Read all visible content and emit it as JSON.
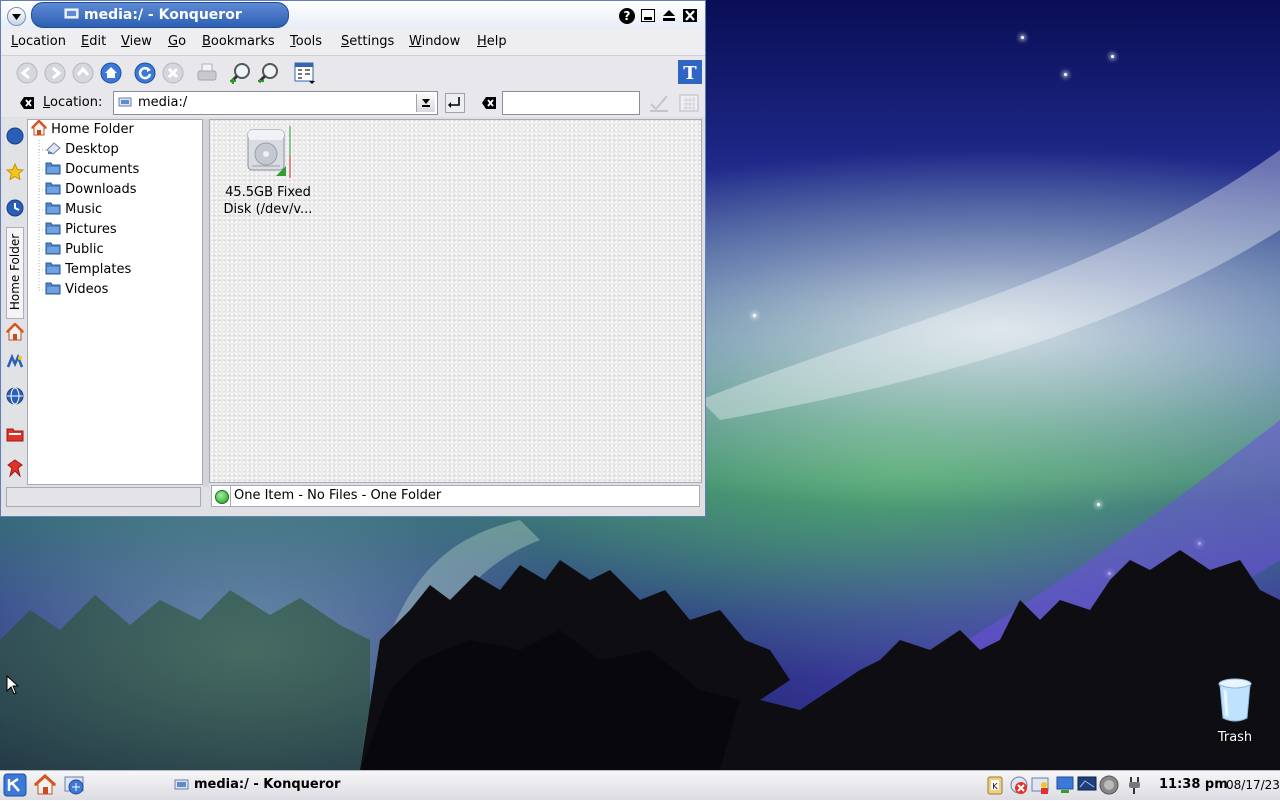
{
  "window": {
    "title": "media:/ - Konqueror"
  },
  "menubar": {
    "items": [
      {
        "label": "Location",
        "accel": "L",
        "rest": "ocation"
      },
      {
        "label": "Edit",
        "accel": "E",
        "rest": "dit"
      },
      {
        "label": "View",
        "accel": "V",
        "rest": "iew"
      },
      {
        "label": "Go",
        "accel": "G",
        "rest": "o"
      },
      {
        "label": "Bookmarks",
        "accel": "B",
        "rest": "ookmarks"
      },
      {
        "label": "Tools",
        "accel": "T",
        "rest": "ools"
      },
      {
        "label": "Settings",
        "accel": "S",
        "rest": "ettings"
      },
      {
        "label": "Window",
        "accel": "W",
        "rest": "indow"
      },
      {
        "label": "Help",
        "accel": "H",
        "rest": "elp"
      }
    ]
  },
  "toolbar": {
    "icons": [
      "back-icon",
      "forward-icon",
      "up-icon",
      "home-icon",
      "reload-icon",
      "stop-icon",
      "print-icon",
      "zoom-in-icon",
      "zoom-out-icon",
      "view-mode-icon",
      "konqueror-logo-icon"
    ]
  },
  "location": {
    "label": "Location:",
    "accel": "L",
    "rest": "ocation:",
    "value": "media:/",
    "search_value": ""
  },
  "tree": {
    "root": "Home Folder",
    "items": [
      "Desktop",
      "Documents",
      "Downloads",
      "Music",
      "Pictures",
      "Public",
      "Templates",
      "Videos"
    ]
  },
  "sidebar_tab": {
    "label": "Home Folder"
  },
  "files": [
    {
      "name_line1": "45.5GB Fixed",
      "name_line2": "Disk (/dev/v...",
      "icon": "hard-disk-icon"
    }
  ],
  "status": {
    "text": "One Item - No Files - One Folder"
  },
  "desktop": {
    "trash_label": "Trash"
  },
  "taskbar": {
    "task_title": "media:/ - Konqueror",
    "clock_time": "11:38 pm",
    "clock_date": "08/17/23"
  },
  "colors": {
    "accent": "#2d5fb3",
    "folder": "#4f86c8"
  }
}
